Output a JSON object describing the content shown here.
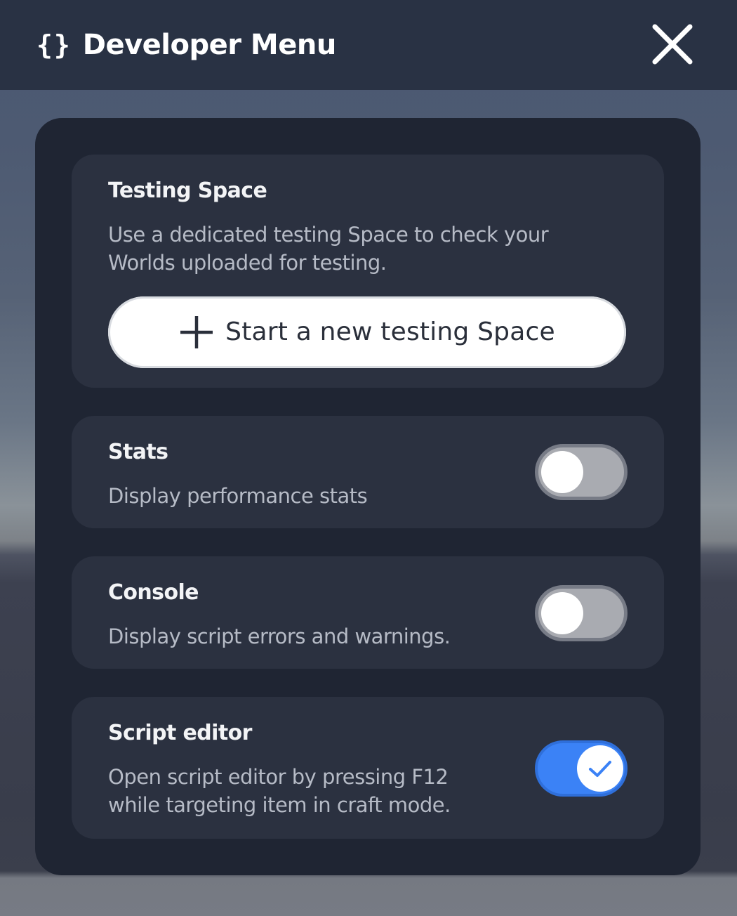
{
  "header": {
    "icon": "braces-icon",
    "icon_glyph": "{}",
    "title": "Developer Menu",
    "close_icon": "close-icon"
  },
  "cards": {
    "testing": {
      "title": "Testing Space",
      "description_line1": "Use a dedicated testing Space to check your",
      "description_line2": "Worlds uploaded for testing.",
      "button_label": "Start a new testing Space",
      "button_icon": "plus-icon"
    },
    "stats": {
      "title": "Stats",
      "description": "Display performance stats",
      "enabled": false
    },
    "console": {
      "title": "Console",
      "description": "Display script errors and warnings.",
      "enabled": false
    },
    "script_editor": {
      "title": "Script editor",
      "description_line1": "Open script editor by pressing F12",
      "description_line2": "while targeting item in craft mode.",
      "enabled": true
    }
  },
  "colors": {
    "header_bg": "#293244",
    "panel_bg": "#1f2533",
    "card_bg": "#2b3140",
    "toggle_on": "#3b82f6",
    "toggle_off": "#a9abb1"
  }
}
